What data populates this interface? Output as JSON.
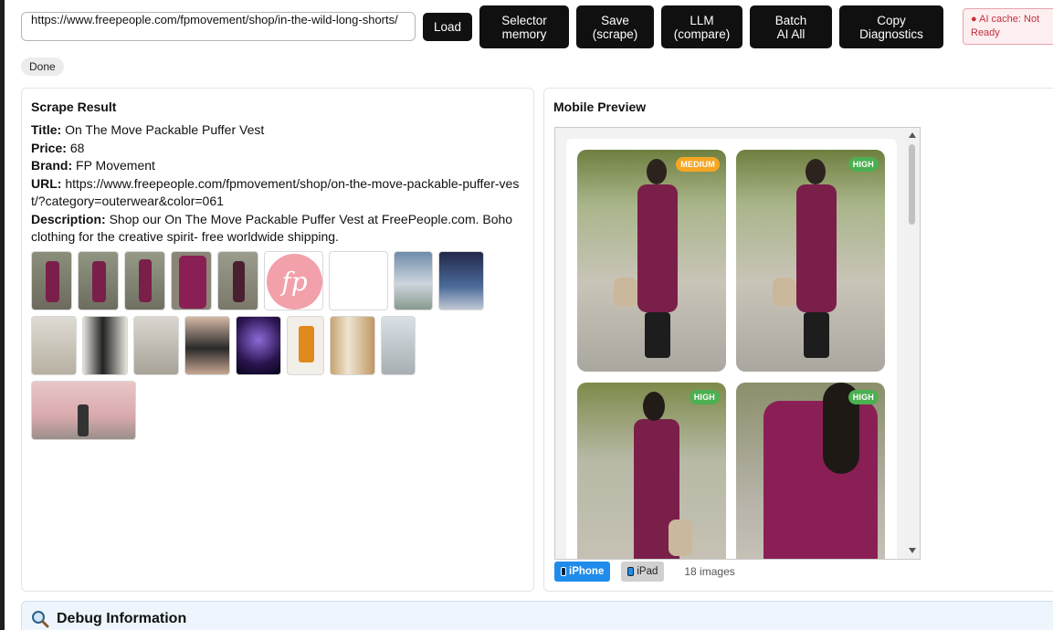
{
  "toolbar": {
    "url_value": "https://www.freepeople.com/fpmovement/shop/in-the-wild-long-shorts/",
    "load_label": "Load",
    "selector_memory_label": "Selector\nmemory",
    "save_label": "Save\n(scrape)",
    "llm_label": "LLM\n(compare)",
    "batch_label": "Batch\nAI All",
    "copy_label": "Copy\nDiagnostics",
    "ai_cache_status": "AI cache: Not Ready",
    "done_label": "Done"
  },
  "scrape": {
    "heading": "Scrape Result",
    "title_label": "Title:",
    "title": "On The Move Packable Puffer Vest",
    "price_label": "Price:",
    "price": "68",
    "brand_label": "Brand:",
    "brand": "FP Movement",
    "url_label": "URL:",
    "url": "https://www.freepeople.com/fpmovement/shop/on-the-move-packable-puffer-vest/?category=outerwear&color=061",
    "desc_label": "Description:",
    "description": "Shop our On The Move Packable Puffer Vest at FreePeople.com. Boho clothing for the creative spirit- free worldwide shipping.",
    "logo_text": "fp"
  },
  "preview": {
    "heading": "Mobile Preview",
    "badges": [
      "MEDIUM",
      "HIGH",
      "HIGH",
      "HIGH"
    ],
    "iphone_label": "iPhone",
    "ipad_label": "iPad",
    "image_count": "18 images"
  },
  "debug": {
    "title": "Debug Information"
  },
  "colors": {
    "badge_medium": "#f5a623",
    "badge_high": "#4caf50",
    "vest": "#7a1f4a"
  }
}
